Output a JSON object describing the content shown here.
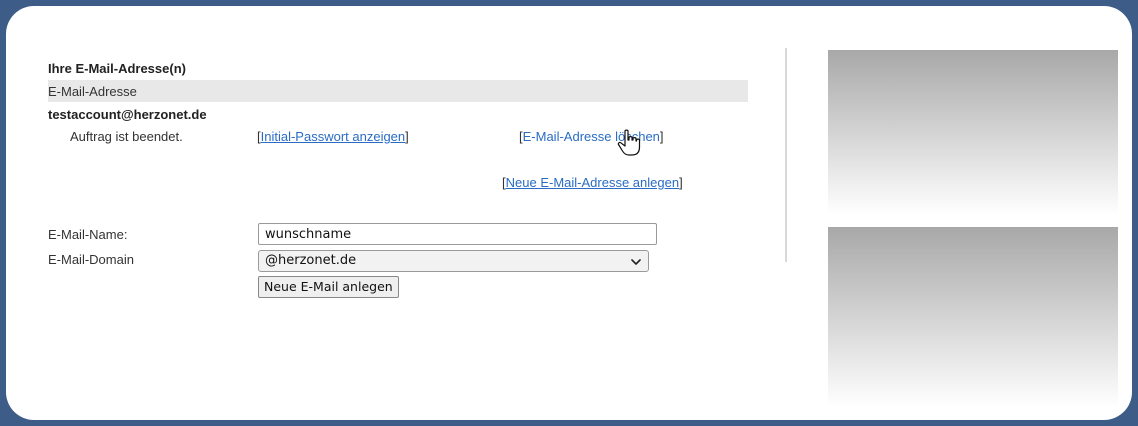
{
  "section_title": "Ihre E-Mail-Adresse(n)",
  "table_header": "E-Mail-Adresse",
  "entry": {
    "address": "testaccount@herzonet.de",
    "status": "Auftrag ist beendet.",
    "initial_password_link": "Initial-Passwort anzeigen",
    "delete_link": "E-Mail-Adresse löschen"
  },
  "new_address_link": "Neue E-Mail-Adresse anlegen",
  "form": {
    "name_label": "E-Mail-Name:",
    "name_value": "wunschname",
    "domain_label": "E-Mail-Domain",
    "domain_selected": "@herzonet.de",
    "submit_label": "Neue E-Mail anlegen"
  },
  "icons": {
    "cursor": "hand-pointer-icon",
    "dropdown": "chevron-down-icon"
  },
  "colors": {
    "border_frame": "#3d5d88",
    "link": "#2a6cc4",
    "header_bar": "#e8e8e8"
  }
}
